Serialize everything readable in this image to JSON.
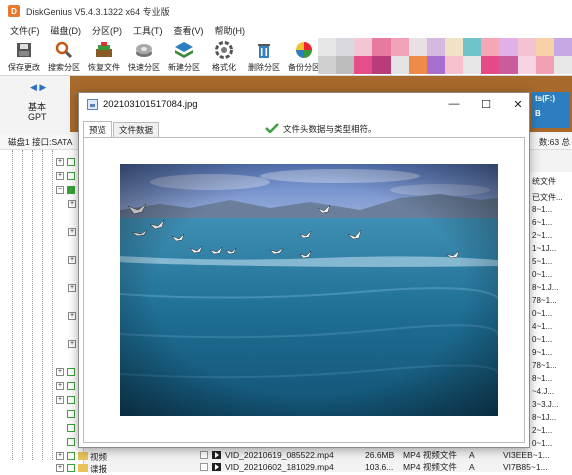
{
  "app": {
    "title": "DiskGenius V5.4.3.1322 x64 专业版",
    "icon_letter": "D",
    "brand_color": "#e8782a"
  },
  "menu": [
    "文件(F)",
    "磁盘(D)",
    "分区(P)",
    "工具(T)",
    "查看(V)",
    "帮助(H)"
  ],
  "toolbar": [
    {
      "label": "保存更改",
      "icon": "save-icon"
    },
    {
      "label": "搜索分区",
      "icon": "search-icon"
    },
    {
      "label": "恢复文件",
      "icon": "recover-icon"
    },
    {
      "label": "快速分区",
      "icon": "quick-partition-icon"
    },
    {
      "label": "新建分区",
      "icon": "new-partition-icon"
    },
    {
      "label": "格式化",
      "icon": "format-icon"
    },
    {
      "label": "删除分区",
      "icon": "delete-partition-icon"
    },
    {
      "label": "备份分区",
      "icon": "backup-partition-icon"
    }
  ],
  "disk": {
    "line1": "基本",
    "line2": "GPT",
    "info": "磁盘1 接口:SATA",
    "info_right": "数:63 总",
    "partition_label_r": "ts(F:)",
    "partition_sub_r": "B"
  },
  "dialog": {
    "title": "20210310151708​4.jpg",
    "tabs": [
      "预览",
      "文件数据"
    ],
    "active_tab": "预览",
    "status": "文件头数据与类型相符。",
    "status_icon": "check-icon"
  },
  "tree": {
    "labels": [
      "视频",
      "谍报"
    ]
  },
  "right_list": {
    "header": "统文件",
    "items": [
      "已文件...",
      "8~1...",
      "6~1...",
      "2~1...",
      "1~1J...",
      "5~1...",
      "0~1...",
      "8~1.J...",
      "78~1...",
      "0~1...",
      "4~1...",
      "0~1...",
      "9~1...",
      "78~1...",
      "8~1...",
      "~4.J...",
      "3~3.J...",
      "8~1J...",
      "2~1...",
      "0~1...",
      "F~1...",
      "VI3EEB~1...",
      "VI7B85~1..."
    ]
  },
  "files": [
    {
      "name": "VID_20210619_085522.mp4",
      "size": "26.6MB",
      "type": "MP4 视频文件",
      "attr": "A"
    },
    {
      "name": "VID_20210602_181029.mp4",
      "size": "103.6...",
      "type": "MP4 视频文件",
      "attr": "A"
    }
  ]
}
